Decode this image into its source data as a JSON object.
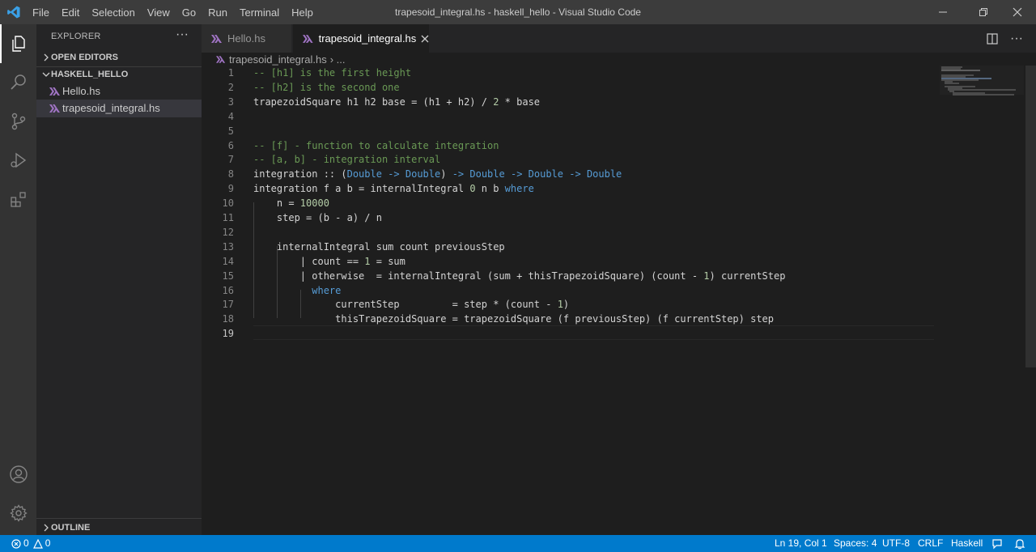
{
  "window": {
    "title": "trapesoid_integral.hs - haskell_hello - Visual Studio Code",
    "menu": [
      "File",
      "Edit",
      "Selection",
      "View",
      "Go",
      "Run",
      "Terminal",
      "Help"
    ]
  },
  "sidebar": {
    "header": "EXPLORER",
    "open_editors": "OPEN EDITORS",
    "folder": "HASKELL_HELLO",
    "files": [
      "Hello.hs",
      "trapesoid_integral.hs"
    ],
    "outline": "OUTLINE"
  },
  "tabs": [
    {
      "label": "Hello.hs",
      "active": false
    },
    {
      "label": "trapesoid_integral.hs",
      "active": true
    }
  ],
  "breadcrumb": {
    "file": "trapesoid_integral.hs",
    "more": "›  ..."
  },
  "editor": {
    "line_numbers": [
      "1",
      "2",
      "3",
      "4",
      "5",
      "6",
      "7",
      "8",
      "9",
      "10",
      "11",
      "12",
      "13",
      "14",
      "15",
      "16",
      "17",
      "18",
      "19"
    ],
    "lines": [
      "-- [h1] is the first height",
      "-- [h2] is the second one",
      "trapezoidSquare h1 h2 base = (h1 + h2) / 2 * base",
      "",
      "",
      "-- [f] - function to calculate integration",
      "-- [a, b] - integration interval",
      "integration :: (Double -> Double) -> Double -> Double -> Double",
      "integration f a b = internalIntegral 0 n b where",
      "    n = 10000",
      "    step = (b - a) / n",
      "",
      "    internalIntegral sum count previousStep",
      "        | count == 1 = sum",
      "        | otherwise  = internalIntegral (sum + thisTrapezoidSquare) (count - 1) currentStep",
      "          where",
      "              currentStep         = step * (count - 1)",
      "              thisTrapezoidSquare = trapezoidSquare (f previousStep) (f currentStep) step",
      ""
    ]
  },
  "status": {
    "errors": "0",
    "warnings": "0",
    "position": "Ln 19, Col 1",
    "spaces": "Spaces: 4",
    "encoding": "UTF-8",
    "eol": "CRLF",
    "language": "Haskell"
  },
  "colors": {
    "accent": "#007acc",
    "haskell_icon": "#a074c4",
    "comment": "#6a9955",
    "keyword": "#569cd6"
  }
}
